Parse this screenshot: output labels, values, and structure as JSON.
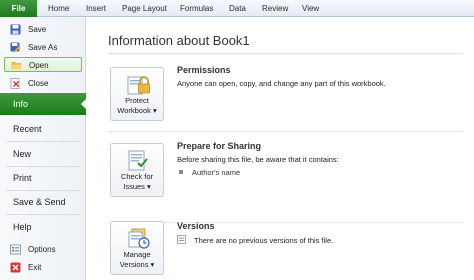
{
  "ribbon": {
    "tabs": [
      "File",
      "Home",
      "Insert",
      "Page Layout",
      "Formulas",
      "Data",
      "Review",
      "View"
    ]
  },
  "backstage": {
    "commands": [
      {
        "label": "Save",
        "icon": "save-icon"
      },
      {
        "label": "Save As",
        "icon": "save-as-icon"
      },
      {
        "label": "Open",
        "icon": "open-folder-icon"
      },
      {
        "label": "Close",
        "icon": "close-file-icon"
      }
    ],
    "tabs": [
      "Info",
      "Recent",
      "New",
      "Print",
      "Save & Send",
      "Help"
    ],
    "footer": [
      {
        "label": "Options",
        "icon": "options-icon"
      },
      {
        "label": "Exit",
        "icon": "exit-icon"
      }
    ],
    "selected_tab": "Info",
    "highlighted_command": "Open"
  },
  "info": {
    "title": "Information about Book1",
    "permissions": {
      "title": "Permissions",
      "description": "Anyone can open, copy, and change any part of this workbook.",
      "button_line1": "Protect",
      "button_line2": "Workbook ▾"
    },
    "sharing": {
      "title": "Prepare for Sharing",
      "description": "Before sharing this file, be aware that it contains:",
      "bullet": "Author's name",
      "button_line1": "Check for",
      "button_line2": "Issues ▾"
    },
    "versions": {
      "title": "Versions",
      "description": "There are no previous versions of this file.",
      "button_line1": "Manage",
      "button_line2": "Versions ▾"
    }
  },
  "colors": {
    "accent": "#2a8a2a",
    "ribbon": "#e4ebf4"
  }
}
